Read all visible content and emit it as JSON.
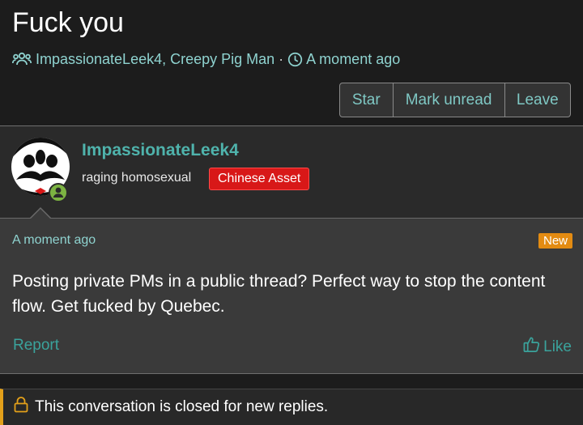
{
  "thread": {
    "title": "Fuck you",
    "participants": "ImpassionateLeek4, Creepy Pig Man",
    "separator": "·",
    "time": "A moment ago"
  },
  "actions": {
    "star_label": "Star",
    "mark_unread_label": "Mark unread",
    "leave_label": "Leave"
  },
  "post": {
    "author": "ImpassionateLeek4",
    "user_title": "raging homosexual",
    "banner": "Chinese Asset",
    "time": "A moment ago",
    "new_badge": "New",
    "body": "Posting private PMs in a public thread? Perfect way to stop the content flow. Get fucked by Quebec.",
    "report_label": "Report",
    "like_label": "Like"
  },
  "notice": {
    "closed_text": "This conversation is closed for new replies."
  },
  "colors": {
    "accent": "#4fb3ac",
    "link": "#3aa39c",
    "banner": "#d81818",
    "new_badge": "#e38b12",
    "notice_bar": "#e3a01a",
    "online": "#7cb342"
  },
  "icons": {
    "participants": "users-icon",
    "time": "clock-icon",
    "online": "user-online-icon",
    "like": "thumbs-up-icon",
    "lock": "lock-icon"
  }
}
